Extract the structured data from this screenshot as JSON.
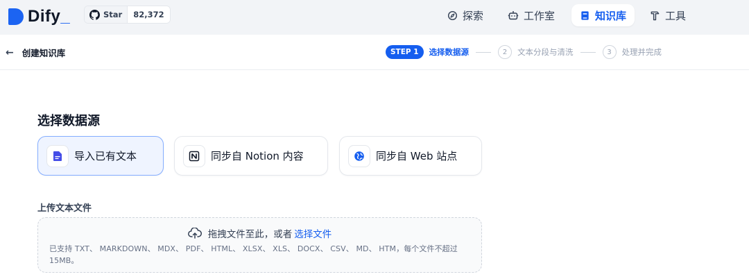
{
  "brand": {
    "name": "Dify",
    "underscore": "_"
  },
  "github": {
    "label": "Star",
    "count": "82,372"
  },
  "nav": [
    {
      "label": "探索",
      "icon": "compass-icon",
      "active": false
    },
    {
      "label": "工作室",
      "icon": "robot-icon",
      "active": false
    },
    {
      "label": "知识库",
      "icon": "book-icon",
      "active": true
    },
    {
      "label": "工具",
      "icon": "hammer-icon",
      "active": false
    }
  ],
  "subheader": {
    "back_label": "创建知识库",
    "steps": {
      "step1_badge": "STEP 1",
      "step1_label": "选择数据源",
      "step2_num": "2",
      "step2_label": "文本分段与清洗",
      "step3_num": "3",
      "step3_label": "处理并完成"
    }
  },
  "main": {
    "title": "选择数据源",
    "sources": [
      {
        "label": "导入已有文本",
        "icon": "file-text-icon",
        "active": true
      },
      {
        "label": "同步自 Notion 内容",
        "icon": "notion-icon",
        "active": false
      },
      {
        "label": "同步自 Web 站点",
        "icon": "globe-icon",
        "active": false
      }
    ],
    "upload": {
      "title": "上传文本文件",
      "prompt": "拖拽文件至此，或者",
      "link": "选择文件",
      "hint": "已支持 TXT、 MARKDOWN、 MDX、 PDF、 HTML、 XLSX、 XLS、 DOCX、 CSV、 MD、 HTM，每个文件不超过 15MB。"
    }
  },
  "colors": {
    "accent": "#155eef",
    "nav_bg": "#f2f4f7"
  }
}
